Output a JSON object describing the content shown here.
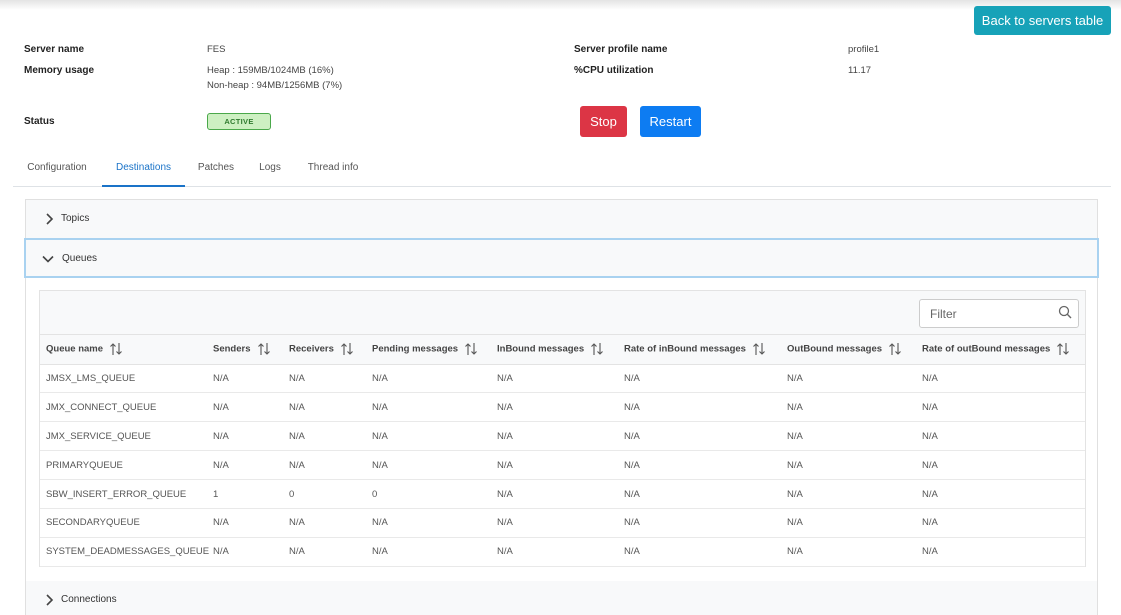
{
  "header": {
    "back_button_label": "Back to servers table"
  },
  "server_info": {
    "server_name_label": "Server name",
    "server_name_value": "FES",
    "memory_usage_label": "Memory usage",
    "memory_heap": "Heap : 159MB/1024MB (16%)",
    "memory_nonheap": "Non-heap : 94MB/1256MB (7%)",
    "profile_label": "Server profile name",
    "profile_value": "profile1",
    "cpu_label": "%CPU utilization",
    "cpu_value": "11.17",
    "status_label": "Status",
    "status_value": "ACTIVE"
  },
  "actions": {
    "stop_label": "Stop",
    "restart_label": "Restart"
  },
  "colors": {
    "stop": "#dc3545",
    "restart": "#0d7cf2",
    "back": "#17a2b8",
    "active_tab": "#1a73c8",
    "status_bg": "#cdf0c2"
  },
  "tabs": [
    {
      "label": "Configuration"
    },
    {
      "label": "Destinations",
      "active": true
    },
    {
      "label": "Patches"
    },
    {
      "label": "Logs"
    },
    {
      "label": "Thread info"
    }
  ],
  "accordion": {
    "topics_label": "Topics",
    "queues_label": "Queues",
    "connections_label": "Connections"
  },
  "filter": {
    "placeholder": "Filter",
    "icon": "search-icon"
  },
  "table": {
    "columns": [
      "Queue name",
      "Senders",
      "Receivers",
      "Pending messages",
      "InBound messages",
      "Rate of inBound messages",
      "OutBound messages",
      "Rate of outBound messages"
    ],
    "rows": [
      [
        "JMSX_LMS_QUEUE",
        "N/A",
        "N/A",
        "N/A",
        "N/A",
        "N/A",
        "N/A",
        "N/A"
      ],
      [
        "JMX_CONNECT_QUEUE",
        "N/A",
        "N/A",
        "N/A",
        "N/A",
        "N/A",
        "N/A",
        "N/A"
      ],
      [
        "JMX_SERVICE_QUEUE",
        "N/A",
        "N/A",
        "N/A",
        "N/A",
        "N/A",
        "N/A",
        "N/A"
      ],
      [
        "PRIMARYQUEUE",
        "N/A",
        "N/A",
        "N/A",
        "N/A",
        "N/A",
        "N/A",
        "N/A"
      ],
      [
        "SBW_INSERT_ERROR_QUEUE",
        "1",
        "0",
        "0",
        "N/A",
        "N/A",
        "N/A",
        "N/A"
      ],
      [
        "SECONDARYQUEUE",
        "N/A",
        "N/A",
        "N/A",
        "N/A",
        "N/A",
        "N/A",
        "N/A"
      ],
      [
        "SYSTEM_DEADMESSAGES_QUEUE",
        "N/A",
        "N/A",
        "N/A",
        "N/A",
        "N/A",
        "N/A",
        "N/A"
      ]
    ]
  }
}
